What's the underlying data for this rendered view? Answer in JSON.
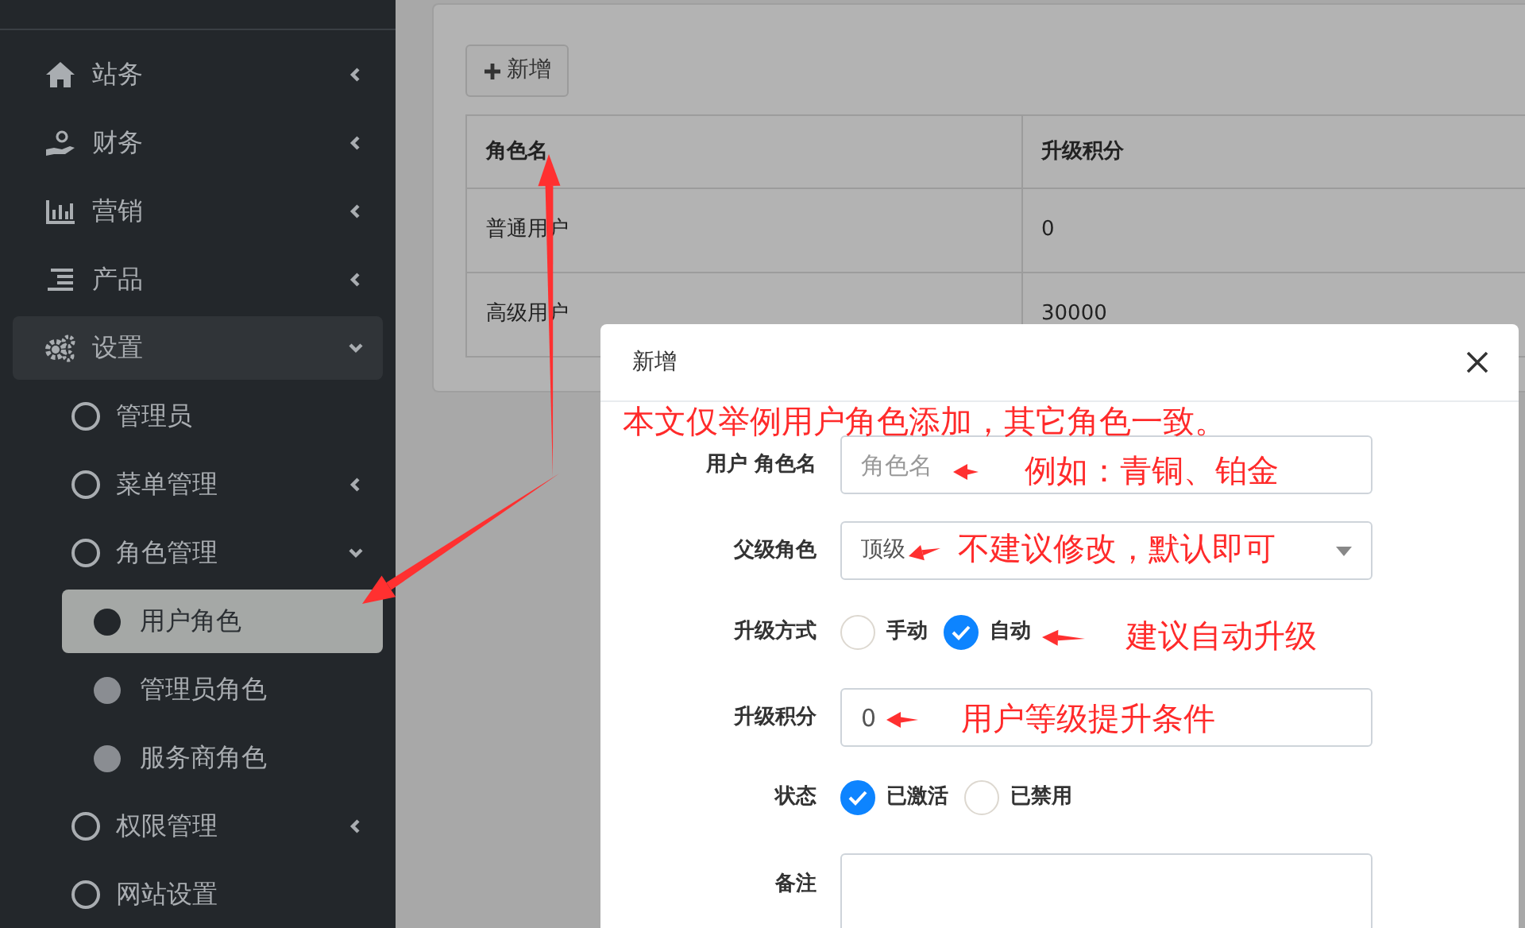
{
  "sidebar": {
    "items": [
      {
        "label": "站务",
        "expanded": false
      },
      {
        "label": "财务",
        "expanded": false
      },
      {
        "label": "营销",
        "expanded": false
      },
      {
        "label": "产品",
        "expanded": false
      },
      {
        "label": "设置",
        "expanded": true,
        "children": [
          {
            "label": "管理员"
          },
          {
            "label": "菜单管理",
            "expanded": false
          },
          {
            "label": "角色管理",
            "expanded": true,
            "children": [
              {
                "label": "用户角色",
                "selected": true
              },
              {
                "label": "管理员角色",
                "selected": false
              },
              {
                "label": "服务商角色",
                "selected": false
              }
            ]
          },
          {
            "label": "权限管理",
            "expanded": false
          },
          {
            "label": "网站设置"
          }
        ]
      }
    ]
  },
  "toolbar": {
    "add_button": "新增"
  },
  "table": {
    "columns": [
      "角色名",
      "升级积分"
    ],
    "rows": [
      [
        "普通用户",
        "0"
      ],
      [
        "高级用户",
        "30000"
      ]
    ]
  },
  "modal": {
    "title": "新增",
    "fields": [
      {
        "kind": "text",
        "label": "用户 角色名",
        "placeholder": "角色名"
      },
      {
        "kind": "select",
        "label": "父级角色",
        "value": "顶级"
      },
      {
        "kind": "radio",
        "label": "升级方式",
        "options": [
          {
            "label": "手动",
            "selected": false
          },
          {
            "label": "自动",
            "selected": true
          }
        ]
      },
      {
        "kind": "text",
        "label": "升级积分",
        "value": "0"
      },
      {
        "kind": "radio",
        "label": "状态",
        "options": [
          {
            "label": "已激活",
            "selected": true
          },
          {
            "label": "已禁用",
            "selected": false
          }
        ]
      },
      {
        "kind": "textarea",
        "label": "备注"
      }
    ]
  },
  "annotations": [
    "本文仅举例用户角色添加，其它角色一致。",
    "例如：青铜、铂金",
    "不建议修改，默认即可",
    "建议自动升级",
    "用户等级提升条件"
  ]
}
